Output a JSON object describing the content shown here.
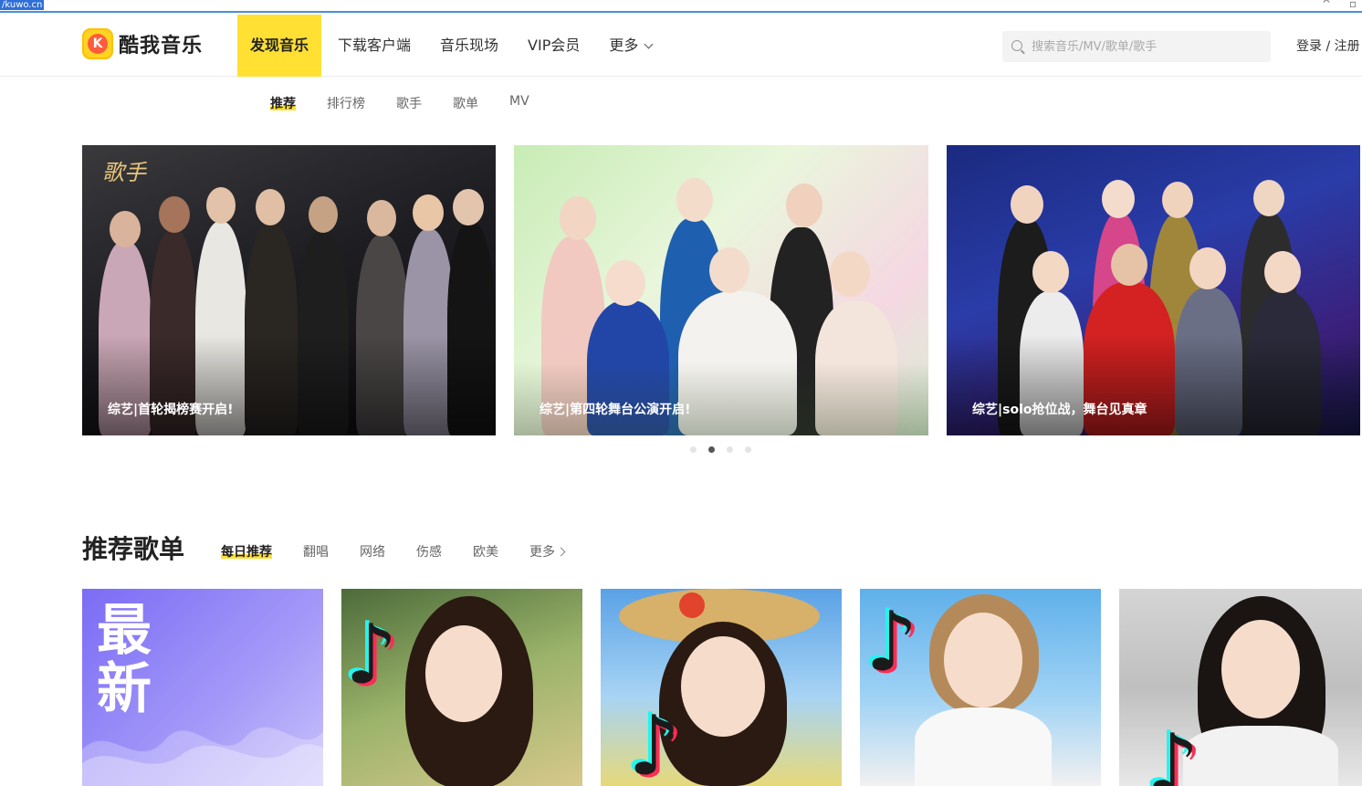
{
  "address_bar": {
    "fragment": "/kuwo.cn"
  },
  "header": {
    "logo_text": "酷我音乐",
    "logo_letter": "K",
    "nav": [
      {
        "label": "发现音乐",
        "active": true
      },
      {
        "label": "下载客户端"
      },
      {
        "label": "音乐现场"
      },
      {
        "label": "VIP会员"
      },
      {
        "label": "更多"
      }
    ],
    "search_placeholder": "搜索音乐/MV/歌单/歌手",
    "login": "登录 / 注册"
  },
  "subnav": [
    {
      "label": "推荐",
      "active": true
    },
    {
      "label": "排行榜"
    },
    {
      "label": "歌手"
    },
    {
      "label": "歌单"
    },
    {
      "label": "MV"
    }
  ],
  "banners": [
    {
      "caption": "综艺|首轮揭榜赛开启!",
      "badge": "歌手"
    },
    {
      "caption": "综艺|第四轮舞台公演开启!",
      "badge": ""
    },
    {
      "caption": "综艺|solo抢位战，舞台见真章",
      "badge": ""
    }
  ],
  "carousel": {
    "count": 4,
    "active_index": 1
  },
  "section": {
    "title": "推荐歌单",
    "tabs": [
      {
        "label": "每日推荐",
        "active": true
      },
      {
        "label": "翻唱"
      },
      {
        "label": "网络"
      },
      {
        "label": "伤感"
      },
      {
        "label": "欧美"
      },
      {
        "label": "更多"
      }
    ]
  },
  "playlists": [
    {
      "cover_text": "最新"
    },
    {
      "cover_text": ""
    },
    {
      "cover_text": ""
    },
    {
      "cover_text": ""
    },
    {
      "cover_text": ""
    }
  ],
  "colors": {
    "accent": "#ffe033",
    "logo_bg": "#ffd323",
    "logo_inner": "#ff5a3c"
  }
}
